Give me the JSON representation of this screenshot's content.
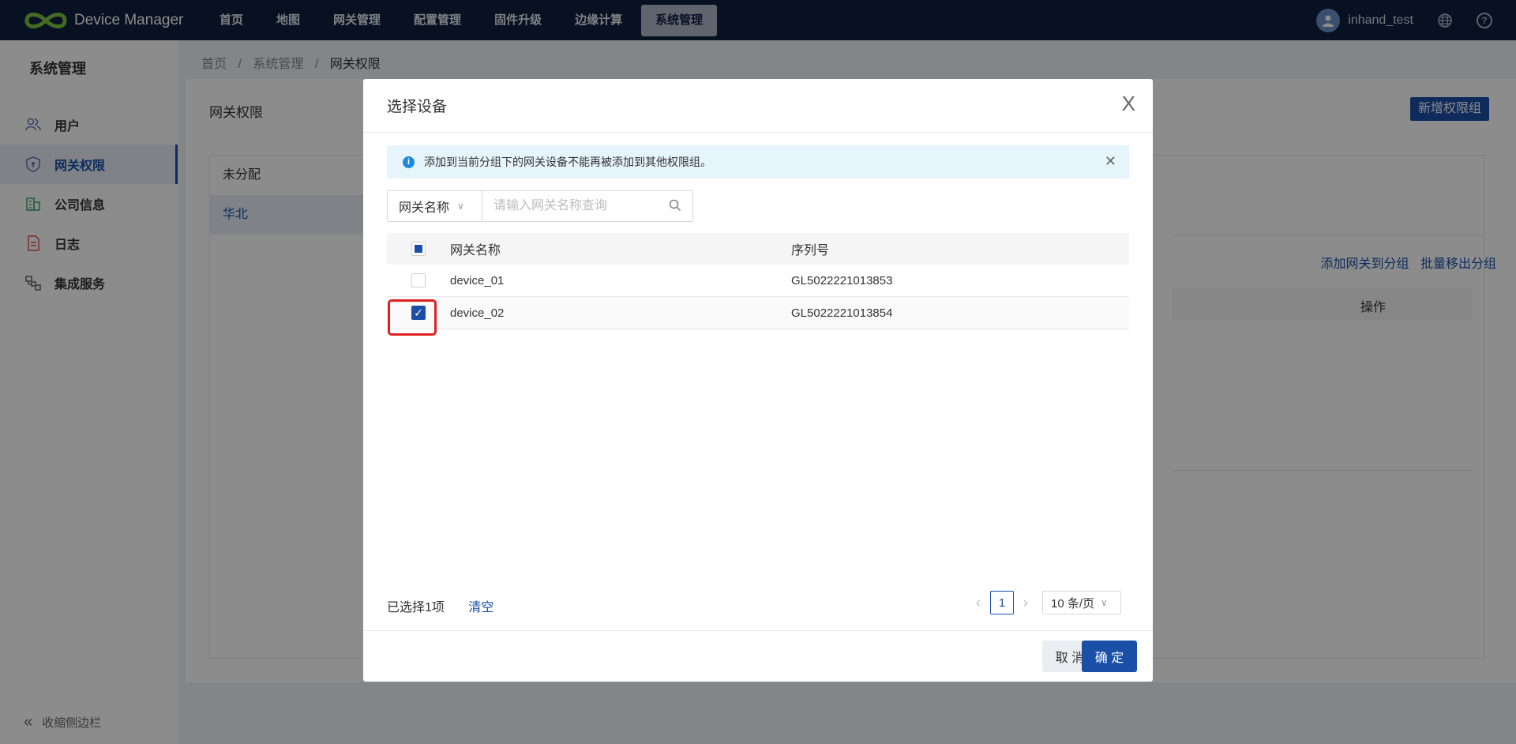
{
  "app": {
    "title": "Device Manager"
  },
  "nav": [
    {
      "label": "首页"
    },
    {
      "label": "地图"
    },
    {
      "label": "网关管理"
    },
    {
      "label": "配置管理"
    },
    {
      "label": "固件升级"
    },
    {
      "label": "边缘计算"
    },
    {
      "label": "系统管理"
    }
  ],
  "user": {
    "name": "inhand_test"
  },
  "sidebar": {
    "title": "系统管理",
    "items": [
      {
        "label": "用户"
      },
      {
        "label": "网关权限"
      },
      {
        "label": "公司信息"
      },
      {
        "label": "日志"
      },
      {
        "label": "集成服务"
      }
    ],
    "collapse_label": "收缩侧边栏"
  },
  "breadcrumb": {
    "home": "首页",
    "sep": "/",
    "section": "系统管理",
    "current": "网关权限"
  },
  "page": {
    "title": "网关权限",
    "new_button": "新增权限组",
    "groups": [
      {
        "label": "未分配"
      },
      {
        "label": "华北"
      }
    ],
    "add_link": "添加网关到分组",
    "remove_link": "批量移出分组",
    "op_header": "操作"
  },
  "modal": {
    "title": "选择设备",
    "close": "X",
    "alert": "添加到当前分组下的网关设备不能再被添加到其他权限组。",
    "search": {
      "field": "网关名称",
      "placeholder": "请输入网关名称查询"
    },
    "columns": {
      "name": "网关名称",
      "sn": "序列号"
    },
    "rows": [
      {
        "name": "device_01",
        "sn": "GL5022221013853",
        "checked": false
      },
      {
        "name": "device_02",
        "sn": "GL5022221013854",
        "checked": true
      }
    ],
    "selected_text": "已选择1项",
    "clear": "清空",
    "pager": {
      "page": "1",
      "size": "10 条/页"
    },
    "cancel": "取 消",
    "ok": "确 定"
  }
}
